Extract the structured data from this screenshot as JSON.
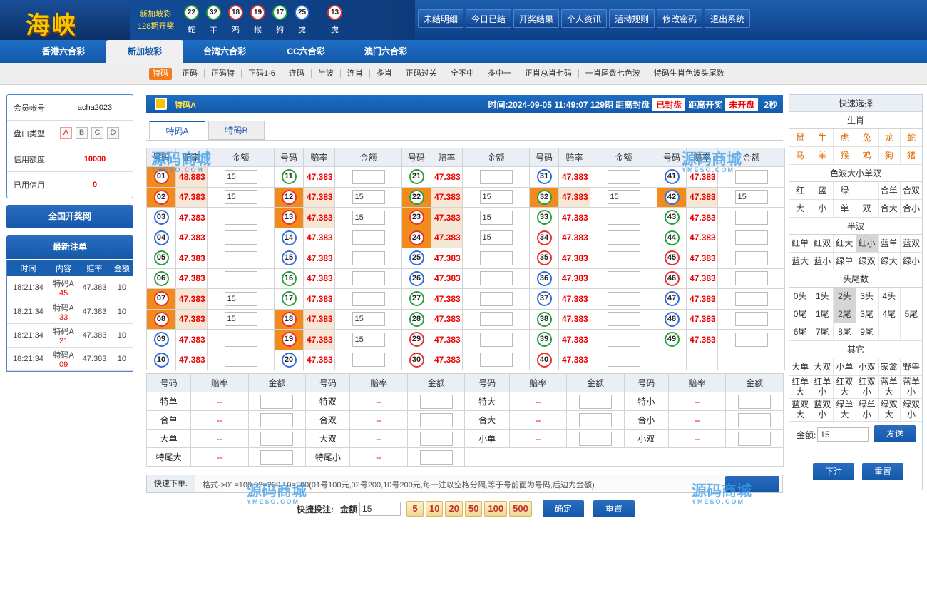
{
  "brand": {
    "logo": "海峡"
  },
  "draw": {
    "lottery": "新加坡彩",
    "period": "128期开奖",
    "balls": [
      {
        "n": "22",
        "z": "蛇",
        "c": "g"
      },
      {
        "n": "32",
        "z": "羊",
        "c": "g"
      },
      {
        "n": "18",
        "z": "鸡",
        "c": "r"
      },
      {
        "n": "19",
        "z": "猴",
        "c": "r"
      },
      {
        "n": "17",
        "z": "狗",
        "c": "g"
      },
      {
        "n": "25",
        "z": "虎",
        "c": "b"
      },
      {
        "n": "13",
        "z": "虎",
        "c": "r"
      }
    ],
    "plus": "+"
  },
  "topnav": [
    "未结明细",
    "今日已结",
    "开奖结果",
    "个人资讯",
    "活动规则",
    "修改密码",
    "退出系统"
  ],
  "tabs": [
    "香港六合彩",
    "新加坡彩",
    "台湾六合彩",
    "CC六合彩",
    "澳门六合彩"
  ],
  "subnav": [
    "特码",
    "正码",
    "正码特",
    "正码1-6",
    "连码",
    "半波",
    "连肖",
    "多肖",
    "正码过关",
    "全不中",
    "多中一",
    "正肖总肖七码",
    "一肖尾数七色波",
    "特码生肖色波头尾数"
  ],
  "account": {
    "id_label": "会员帐号:",
    "id": "acha2023",
    "pan_label": "盘口类型:",
    "pans": [
      "A",
      "B",
      "C",
      "D"
    ],
    "credit_label": "信用额度:",
    "credit": "10000",
    "used_label": "已用信用:",
    "used": "0"
  },
  "side": {
    "national": "全国开奖网",
    "recent": "最新注单",
    "cols": [
      "时间",
      "内容",
      "赔率",
      "金额"
    ],
    "rows": [
      {
        "t": "18:21:34",
        "c1": "特码A",
        "c2": "45",
        "o": "47.383",
        "a": "10"
      },
      {
        "t": "18:21:34",
        "c1": "特码A",
        "c2": "33",
        "o": "47.383",
        "a": "10"
      },
      {
        "t": "18:21:34",
        "c1": "特码A",
        "c2": "21",
        "o": "47.383",
        "a": "10"
      },
      {
        "t": "18:21:34",
        "c1": "特码A",
        "c2": "09",
        "o": "47.383",
        "a": "10"
      }
    ]
  },
  "main": {
    "title": "特码A",
    "time": "时间:2024-09-05 11:49:07 129期 距离封盘",
    "close": "已封盘",
    "open_label": "距离开奖",
    "open": "未开盘",
    "secs": "2秒",
    "subtabs": [
      "特码A",
      "特码B"
    ],
    "cols": [
      "号码",
      "赔率",
      "金额"
    ]
  },
  "balls": [
    {
      "n": "01",
      "c": "r",
      "o": "48.883",
      "a": "15",
      "hl": 1
    },
    {
      "n": "02",
      "c": "r",
      "o": "47.383",
      "a": "15",
      "hl": 1
    },
    {
      "n": "03",
      "c": "b",
      "o": "47.383",
      "a": ""
    },
    {
      "n": "04",
      "c": "b",
      "o": "47.383",
      "a": ""
    },
    {
      "n": "05",
      "c": "g",
      "o": "47.383",
      "a": ""
    },
    {
      "n": "06",
      "c": "g",
      "o": "47.383",
      "a": ""
    },
    {
      "n": "07",
      "c": "r",
      "o": "47.383",
      "a": "15",
      "hl": 1
    },
    {
      "n": "08",
      "c": "r",
      "o": "47.383",
      "a": "15",
      "hl": 1
    },
    {
      "n": "09",
      "c": "b",
      "o": "47.383",
      "a": ""
    },
    {
      "n": "10",
      "c": "b",
      "o": "47.383",
      "a": ""
    },
    {
      "n": "11",
      "c": "g",
      "o": "47.383",
      "a": ""
    },
    {
      "n": "12",
      "c": "r",
      "o": "47.383",
      "a": "15",
      "hl": 1
    },
    {
      "n": "13",
      "c": "r",
      "o": "47.383",
      "a": "15",
      "hl": 1
    },
    {
      "n": "14",
      "c": "b",
      "o": "47.383",
      "a": ""
    },
    {
      "n": "15",
      "c": "b",
      "o": "47.383",
      "a": ""
    },
    {
      "n": "16",
      "c": "g",
      "o": "47.383",
      "a": ""
    },
    {
      "n": "17",
      "c": "g",
      "o": "47.383",
      "a": ""
    },
    {
      "n": "18",
      "c": "r",
      "o": "47.383",
      "a": "15",
      "hl": 1
    },
    {
      "n": "19",
      "c": "r",
      "o": "47.383",
      "a": "15",
      "hl": 1
    },
    {
      "n": "20",
      "c": "b",
      "o": "47.383",
      "a": ""
    },
    {
      "n": "21",
      "c": "g",
      "o": "47.383",
      "a": ""
    },
    {
      "n": "22",
      "c": "g",
      "o": "47.383",
      "a": "15",
      "hl": 1
    },
    {
      "n": "23",
      "c": "r",
      "o": "47.383",
      "a": "15",
      "hl": 1
    },
    {
      "n": "24",
      "c": "r",
      "o": "47.383",
      "a": "15",
      "hl": 1
    },
    {
      "n": "25",
      "c": "b",
      "o": "47.383",
      "a": ""
    },
    {
      "n": "26",
      "c": "b",
      "o": "47.383",
      "a": ""
    },
    {
      "n": "27",
      "c": "g",
      "o": "47.383",
      "a": ""
    },
    {
      "n": "28",
      "c": "g",
      "o": "47.383",
      "a": ""
    },
    {
      "n": "29",
      "c": "r",
      "o": "47.383",
      "a": ""
    },
    {
      "n": "30",
      "c": "r",
      "o": "47.383",
      "a": ""
    },
    {
      "n": "31",
      "c": "b",
      "o": "47.383",
      "a": ""
    },
    {
      "n": "32",
      "c": "g",
      "o": "47.383",
      "a": "15",
      "hl": 1
    },
    {
      "n": "33",
      "c": "g",
      "o": "47.383",
      "a": ""
    },
    {
      "n": "34",
      "c": "r",
      "o": "47.383",
      "a": ""
    },
    {
      "n": "35",
      "c": "r",
      "o": "47.383",
      "a": ""
    },
    {
      "n": "36",
      "c": "b",
      "o": "47.383",
      "a": ""
    },
    {
      "n": "37",
      "c": "b",
      "o": "47.383",
      "a": ""
    },
    {
      "n": "38",
      "c": "g",
      "o": "47.383",
      "a": ""
    },
    {
      "n": "39",
      "c": "g",
      "o": "47.383",
      "a": ""
    },
    {
      "n": "40",
      "c": "r",
      "o": "47.383",
      "a": ""
    },
    {
      "n": "41",
      "c": "b",
      "o": "47.383",
      "a": ""
    },
    {
      "n": "42",
      "c": "b",
      "o": "47.383",
      "a": "15",
      "hl": 1
    },
    {
      "n": "43",
      "c": "g",
      "o": "47.383",
      "a": ""
    },
    {
      "n": "44",
      "c": "g",
      "o": "47.383",
      "a": ""
    },
    {
      "n": "45",
      "c": "r",
      "o": "47.383",
      "a": ""
    },
    {
      "n": "46",
      "c": "r",
      "o": "47.383",
      "a": ""
    },
    {
      "n": "47",
      "c": "b",
      "o": "47.383",
      "a": ""
    },
    {
      "n": "48",
      "c": "b",
      "o": "47.383",
      "a": ""
    },
    {
      "n": "49",
      "c": "g",
      "o": "47.383",
      "a": ""
    }
  ],
  "props": [
    [
      "特单",
      "特双",
      "特大",
      "特小"
    ],
    [
      "合单",
      "合双",
      "合大",
      "合小"
    ],
    [
      "大单",
      "大双",
      "小单",
      "小双"
    ],
    [
      "特尾大",
      "特尾小"
    ]
  ],
  "dash": "--",
  "fast": {
    "label": "快速下单:",
    "format": "格式->01=100 02=200 10=200(01号100元,02号200,10号200元,每一注以空格分隔,等于号前面为号码,后边为金额)"
  },
  "qbet": {
    "label": "快捷投注:",
    "amt_label": "金额",
    "amt": "15",
    "chips": [
      "5",
      "10",
      "20",
      "50",
      "100",
      "500"
    ],
    "ok": "确定",
    "reset": "重置"
  },
  "quick": {
    "title": "快速选择",
    "zodiac_h": "生肖",
    "zodiac": [
      [
        "鼠",
        "牛",
        "虎",
        "兔",
        "龙",
        "蛇"
      ],
      [
        "马",
        "羊",
        "猴",
        "鸡",
        "狗",
        "猪"
      ]
    ],
    "color_h": "色波大小单双",
    "color": [
      [
        "红",
        "蓝",
        "绿",
        "",
        "合单",
        "合双"
      ],
      [
        "大",
        "小",
        "单",
        "双",
        "合大",
        "合小"
      ]
    ],
    "half_h": "半波",
    "half": [
      [
        "红单",
        "红双",
        "红大",
        "红小",
        "蓝单",
        "蓝双"
      ],
      [
        "蓝大",
        "蓝小",
        "绿单",
        "绿双",
        "绿大",
        "绿小"
      ]
    ],
    "tail_h": "头尾数",
    "tail": [
      [
        "0头",
        "1头",
        "2头",
        "3头",
        "4头",
        ""
      ],
      [
        "0尾",
        "1尾",
        "2尾",
        "3尾",
        "4尾",
        "5尾"
      ],
      [
        "6尾",
        "7尾",
        "8尾",
        "9尾",
        "",
        ""
      ]
    ],
    "other_h": "其它",
    "other1": [
      "大单",
      "大双",
      "小单",
      "小双",
      "家禽",
      "野兽"
    ],
    "other2": [
      [
        "红单",
        "大"
      ],
      [
        "红单",
        "小"
      ],
      [
        "红双",
        "大"
      ],
      [
        "红双",
        "小"
      ],
      [
        "蓝单",
        "大"
      ],
      [
        "蓝单",
        "小"
      ]
    ],
    "other3": [
      [
        "蓝双",
        "大"
      ],
      [
        "蓝双",
        "小"
      ],
      [
        "绿单",
        "大"
      ],
      [
        "绿单",
        "小"
      ],
      [
        "绿双",
        "大"
      ],
      [
        "绿双",
        "小"
      ]
    ],
    "amt_label": "金额:",
    "amt": "15",
    "send": "发送",
    "order": "下注",
    "reset": "重置"
  },
  "watermark": {
    "text": "源码商城",
    "sub": "YMESO.COM"
  },
  "colors": {
    "red": "#e8322f",
    "blue": "#2f6fe0",
    "green": "#24a33a",
    "accent": "#f28a1c"
  }
}
